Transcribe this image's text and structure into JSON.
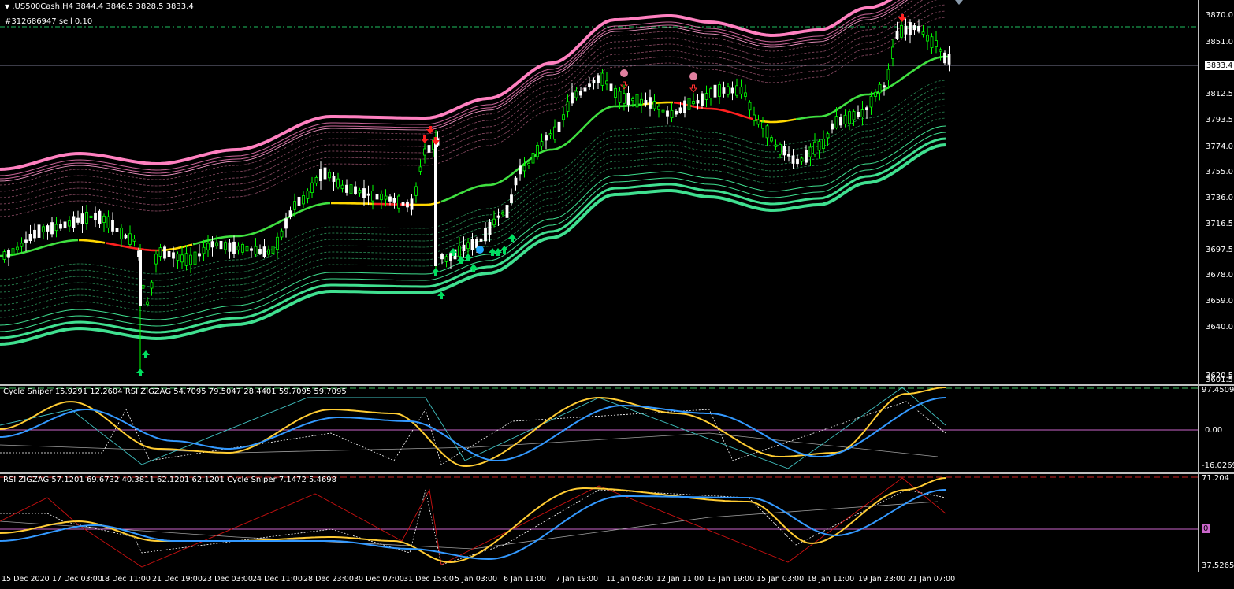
{
  "symbol_header": {
    "symbol": ".US500Cash,H4",
    "ohlc": "3844.4 3846.5 3828.5 3833.4"
  },
  "order_label": "#312686947 sell 0.10",
  "current_price_label": "3833.4",
  "main_pane": {
    "price_ticks": [
      "3870.0",
      "3851.0",
      "3812.5",
      "3793.5",
      "3774.0",
      "3755.0",
      "3736.0",
      "3716.5",
      "3697.5",
      "3678.0",
      "3659.0",
      "3640.0",
      "3620.5",
      "3601.5"
    ]
  },
  "pane2": {
    "header": "Cycle Sniper 15.9291 12.2604  RSI ZIGZAG 54.7095 79.5047 28.4401 59.7095 59.7095",
    "ticks": [
      "97.4509",
      "0.00",
      "-16.0269"
    ]
  },
  "pane3": {
    "header": "RSI ZIGZAG 57.1201 69.6732 40.3811 62.1201 62.1201   Cycle Sniper 7.1472 5.4698",
    "ticks": [
      "71.204",
      "0",
      "37.5265"
    ]
  },
  "time_axis": {
    "labels": [
      "15 Dec 2020",
      "17 Dec 03:00",
      "18 Dec 11:00",
      "21 Dec 19:00",
      "23 Dec 03:00",
      "24 Dec 11:00",
      "28 Dec 23:00",
      "30 Dec 07:00",
      "31 Dec 15:00",
      "5 Jan 03:00",
      "6 Jan 11:00",
      "7 Jan 19:00",
      "11 Jan 03:00",
      "12 Jan 11:00",
      "13 Jan 19:00",
      "15 Jan 03:00",
      "18 Jan 11:00",
      "19 Jan 23:00",
      "21 Jan 07:00"
    ]
  },
  "colors": {
    "background": "#000000",
    "bull_candle": "#00ff00",
    "bear_candle": "#ffffff",
    "upper_band": "#ff80c0",
    "lower_band": "#40e090",
    "mid_green": "#40e040",
    "mid_red": "#ff2020",
    "mid_yellow": "#ffd700",
    "osc_blue": "#3399ff",
    "osc_yellow": "#ffcc33",
    "zigzag_red": "#cc1111",
    "zero_line": "#cc66cc"
  }
}
